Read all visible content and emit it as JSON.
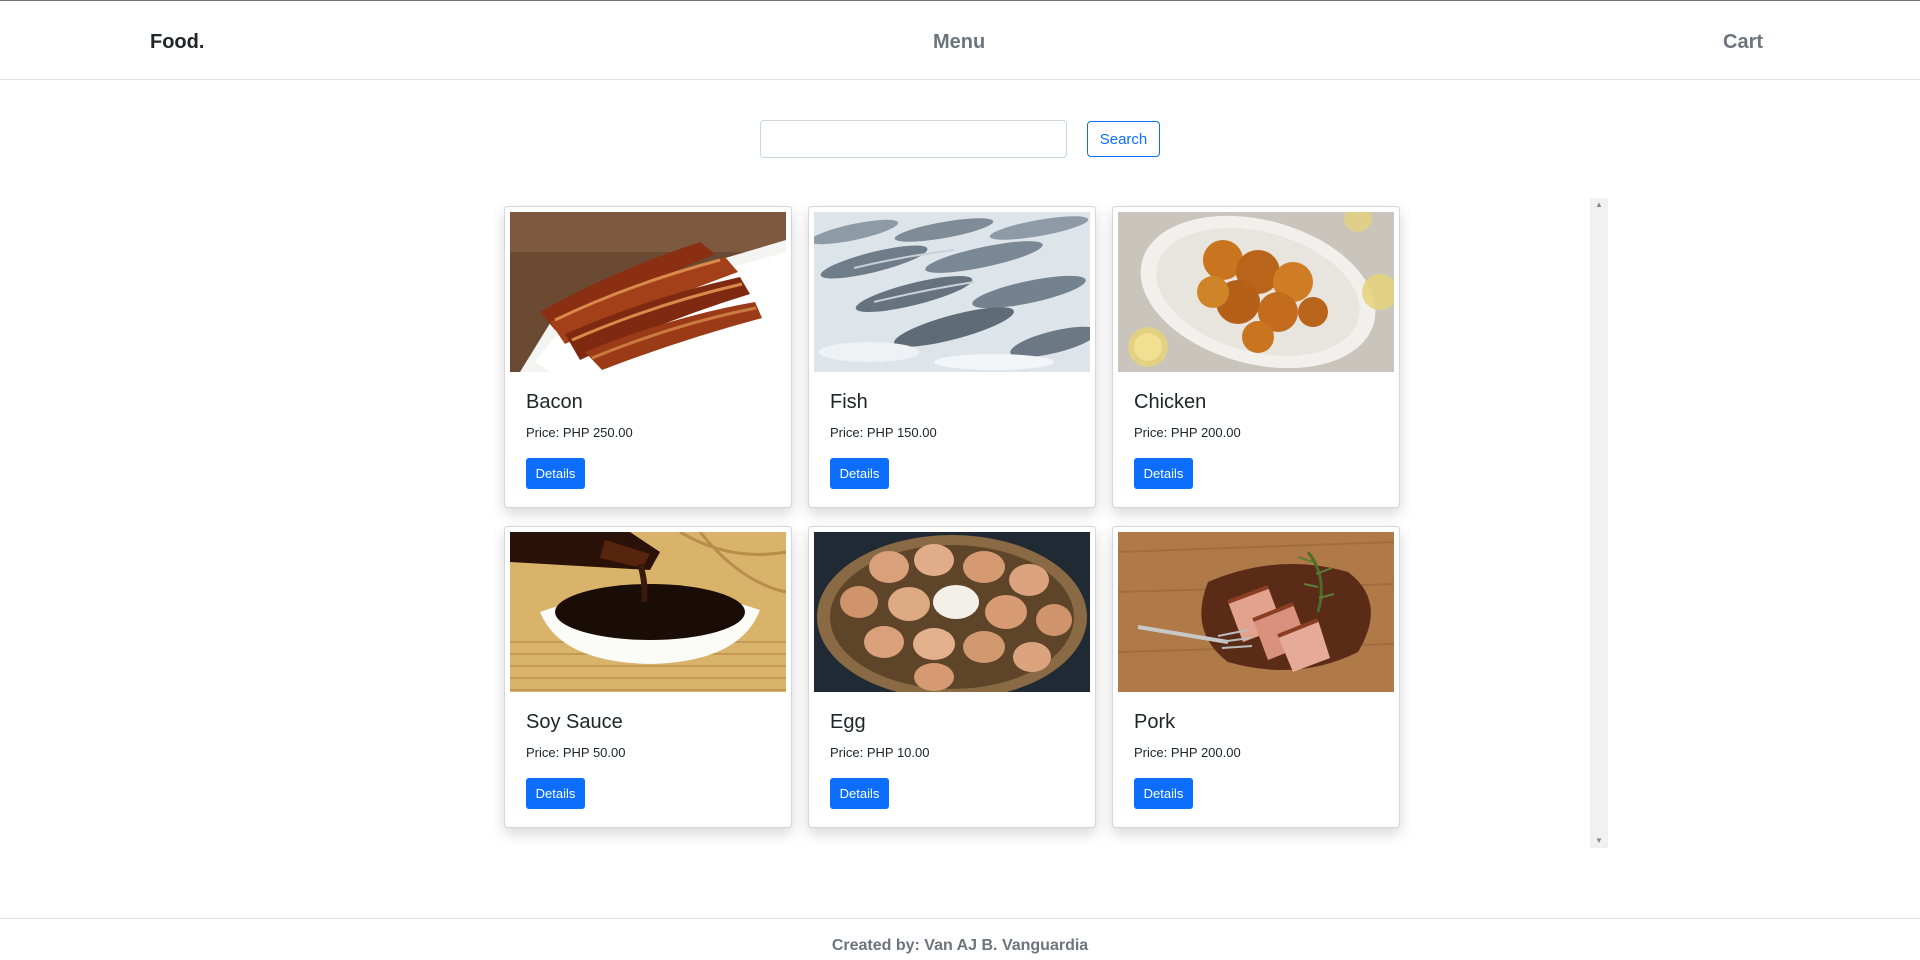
{
  "navbar": {
    "brand": "Food.",
    "menu_label": "Menu",
    "cart_label": "Cart"
  },
  "search": {
    "value": "",
    "placeholder": "",
    "button_label": "Search"
  },
  "products": [
    {
      "name": "Bacon",
      "price": "Price: PHP 250.00",
      "button_label": "Details",
      "image": "bacon-photo"
    },
    {
      "name": "Fish",
      "price": "Price: PHP 150.00",
      "button_label": "Details",
      "image": "fish-photo"
    },
    {
      "name": "Chicken",
      "price": "Price: PHP 200.00",
      "button_label": "Details",
      "image": "fried-chicken-photo"
    },
    {
      "name": "Soy Sauce",
      "price": "Price: PHP 50.00",
      "button_label": "Details",
      "image": "soy-sauce-photo"
    },
    {
      "name": "Egg",
      "price": "Price: PHP 10.00",
      "button_label": "Details",
      "image": "egg-basket-photo"
    },
    {
      "name": "Pork",
      "price": "Price: PHP 200.00",
      "button_label": "Details",
      "image": "pork-steak-photo"
    }
  ],
  "footer": {
    "text": "Created by: Van AJ B. Vanguardia"
  },
  "colors": {
    "primary": "#0d6efd",
    "muted": "#6c757d",
    "text": "#212529"
  }
}
